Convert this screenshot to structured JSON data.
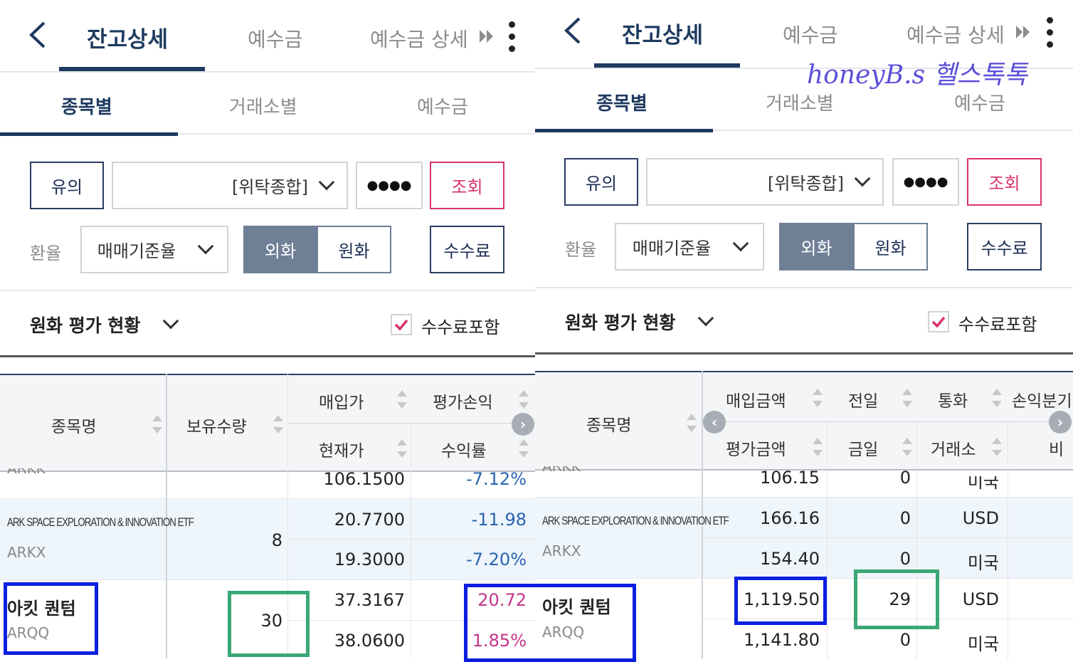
{
  "left": {
    "header": {
      "back_icon": "chevron-left-icon",
      "tab_active": "잔고상세",
      "tab_deposit": "예수금",
      "tab_deposit_detail": "예수금 상세",
      "more_icon": "kebab-menu-icon"
    },
    "subtabs": [
      "종목별",
      "거래소별",
      "예수금"
    ],
    "controls": {
      "caution": "유의",
      "account_type": "[위탁종합]",
      "password_mask": "●●●●",
      "inquiry": "조회",
      "exchange_rate_label": "환율",
      "rate_select": "매매기준율",
      "seg_foreign": "외화",
      "seg_won": "원화",
      "fee": "수수료"
    },
    "summary": {
      "title": "원화 평가 현황",
      "fee_included": "수수료포함"
    },
    "columns": {
      "name": "종목명",
      "qty": "보유수량",
      "buy_price": "매입가",
      "eval_pl": "평가손익",
      "cur_price": "현재가",
      "return_rate": "수익률"
    },
    "rows": [
      {
        "ticker": "ARKK",
        "qty": "",
        "buy_price": "",
        "cur_price": "106.1500",
        "eval_pl": "",
        "return_rate": "-7.12%"
      },
      {
        "name_en": "ARK SPACE EXPLORATION & INNOVATION ETF",
        "ticker": "ARKX",
        "qty": "8",
        "buy_price": "20.7700",
        "cur_price": "19.3000",
        "eval_pl": "-11.98",
        "return_rate": "-7.20%"
      },
      {
        "name_kr": "아킷 퀀텀",
        "ticker": "ARQQ",
        "qty": "30",
        "buy_price": "37.3167",
        "cur_price": "38.0600",
        "eval_pl": "20.72",
        "return_rate": "1.85%"
      }
    ]
  },
  "right": {
    "header": {
      "back_icon": "chevron-left-icon",
      "tab_active": "잔고상세",
      "tab_deposit": "예수금",
      "tab_deposit_detail": "예수금 상세",
      "more_icon": "kebab-menu-icon"
    },
    "watermark": "honeyB.s 헬스톡톡",
    "subtabs": [
      "종목별",
      "거래소별",
      "예수금"
    ],
    "controls": {
      "caution": "유의",
      "account_type": "[위탁종합]",
      "password_mask": "●●●●",
      "inquiry": "조회",
      "exchange_rate_label": "환율",
      "rate_select": "매매기준율",
      "seg_foreign": "외화",
      "seg_won": "원화",
      "fee": "수수료"
    },
    "summary": {
      "title": "원화 평가 현황",
      "fee_included": "수수료포함"
    },
    "columns": {
      "name": "종목명",
      "buy_amount": "매입금액",
      "prev_day": "전일",
      "currency": "통화",
      "breakeven": "손익분기",
      "eval_amount": "평가금액",
      "today": "금일",
      "exchange": "거래소",
      "ratio": "비"
    },
    "rows": [
      {
        "ticker": "ARKK",
        "buy_amount": "",
        "eval_amount": "106.15",
        "prev_day": "",
        "today": "0",
        "currency": "",
        "exchange": "미국"
      },
      {
        "name_en": "ARK SPACE EXPLORATION & INNOVATION ETF",
        "ticker": "ARKX",
        "buy_amount": "166.16",
        "eval_amount": "154.40",
        "prev_day": "0",
        "today": "0",
        "currency": "USD",
        "exchange": "미국"
      },
      {
        "name_kr": "아킷 퀀텀",
        "ticker": "ARQQ",
        "buy_amount": "1,119.50",
        "eval_amount": "1,141.80",
        "prev_day": "29",
        "today": "0",
        "currency": "USD",
        "exchange": "미국"
      }
    ]
  }
}
